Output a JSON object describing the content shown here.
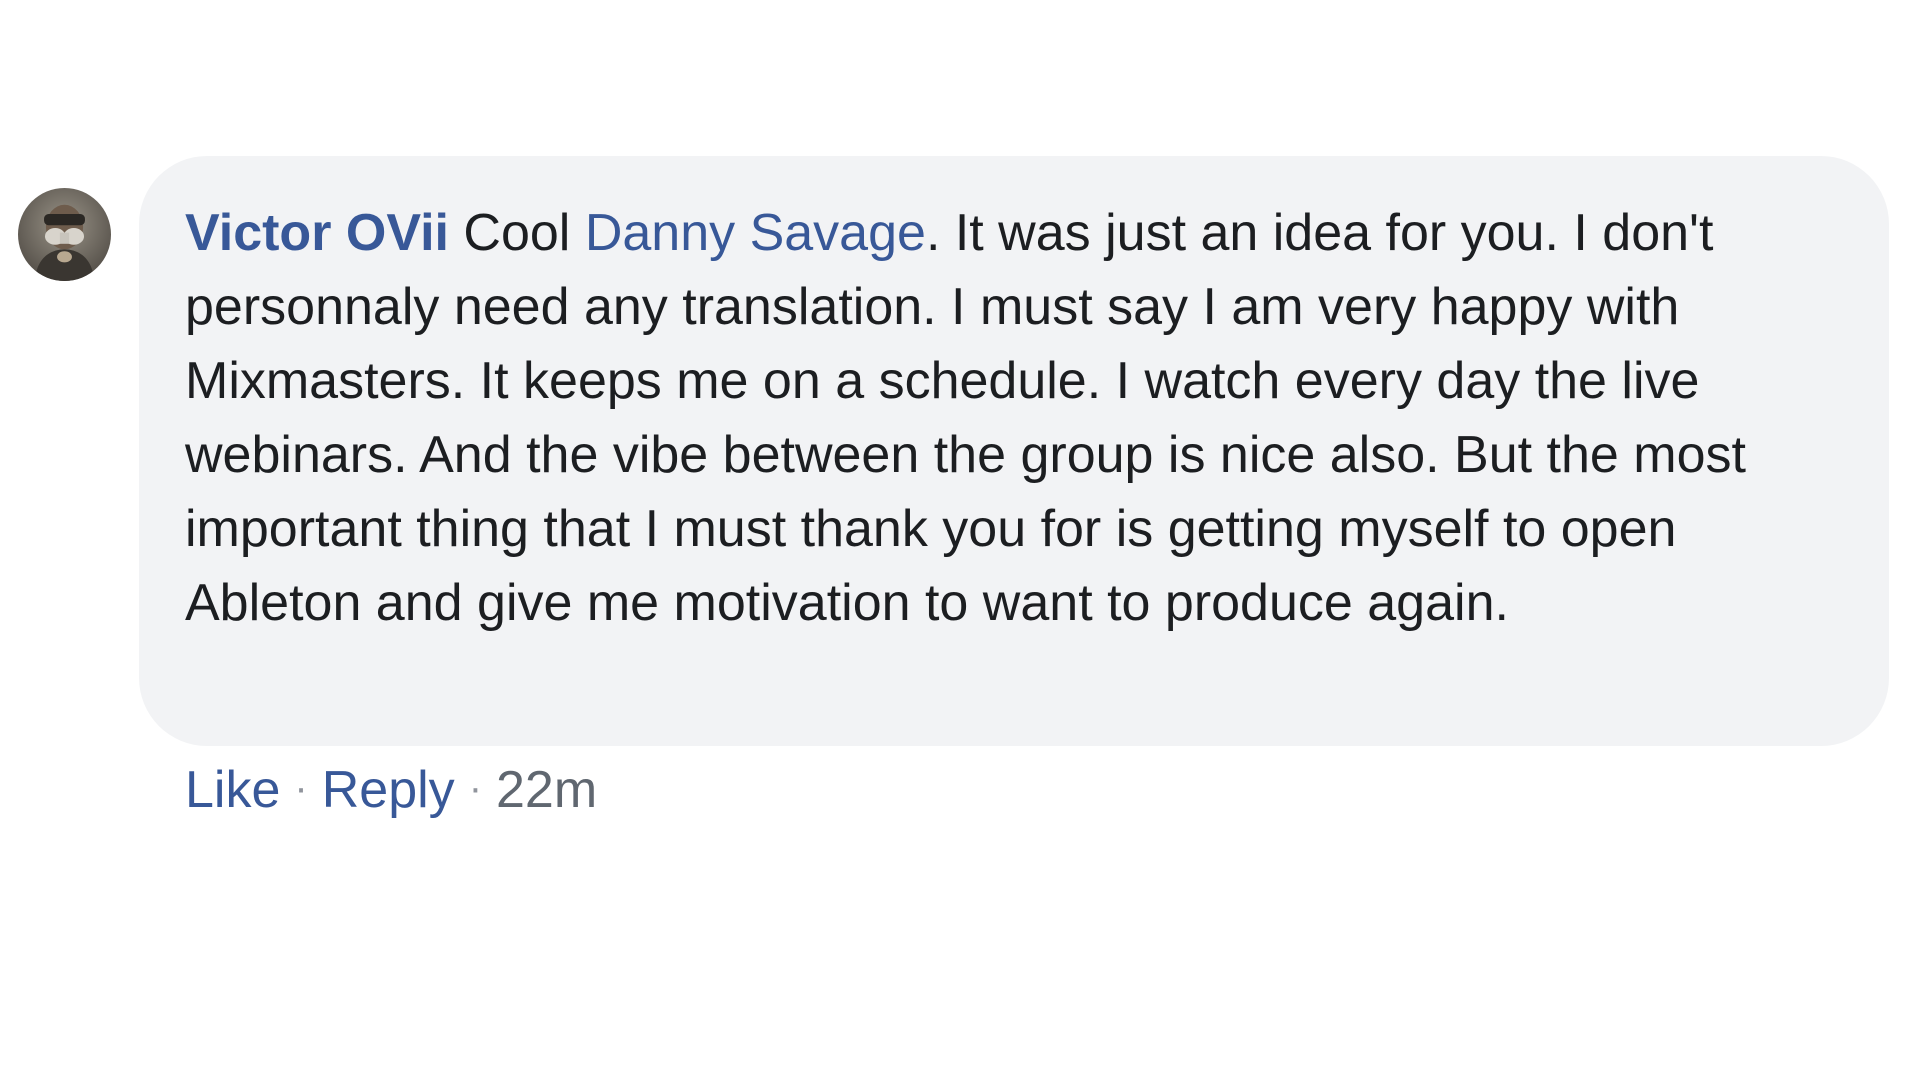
{
  "comment": {
    "author": "Victor OVii",
    "text_before_mention": " Cool ",
    "mention": "Danny Savage",
    "text_after_mention": ". It was just an idea for you. I don't personnaly need any translation. I must say I am very happy with Mixmasters. It keeps me on a schedule. I watch every day the live webinars. And the vibe between the group is nice also. But the most important thing that I must thank you for is getting myself to open Ableton and give me motivation to want to produce again."
  },
  "actions": {
    "like_label": "Like",
    "separator": "·",
    "reply_label": "Reply",
    "timestamp": "22m"
  },
  "colors": {
    "link": "#385898",
    "text": "#1c1e21",
    "bubble_background": "#f2f3f5",
    "meta_text": "#606770"
  },
  "icons": {
    "avatar": "user-profile-photo"
  }
}
